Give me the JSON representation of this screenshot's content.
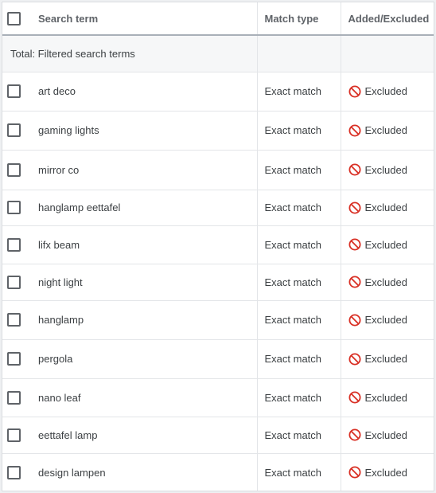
{
  "header": {
    "search_term": "Search term",
    "match_type": "Match type",
    "added_excluded": "Added/Excluded"
  },
  "total": {
    "label": "Total: Filtered search terms"
  },
  "rows": [
    {
      "term": "art deco",
      "match": "Exact match",
      "status": "Excluded"
    },
    {
      "term": "gaming lights",
      "match": "Exact match",
      "status": "Excluded"
    },
    {
      "term": "mirror co",
      "match": "Exact match",
      "status": "Excluded"
    },
    {
      "term": "hanglamp eettafel",
      "match": "Exact match",
      "status": "Excluded"
    },
    {
      "term": "lifx beam",
      "match": "Exact match",
      "status": "Excluded"
    },
    {
      "term": "night light",
      "match": "Exact match",
      "status": "Excluded"
    },
    {
      "term": "hanglamp",
      "match": "Exact match",
      "status": "Excluded"
    },
    {
      "term": "pergola",
      "match": "Exact match",
      "status": "Excluded"
    },
    {
      "term": "nano leaf",
      "match": "Exact match",
      "status": "Excluded"
    },
    {
      "term": "eettafel lamp",
      "match": "Exact match",
      "status": "Excluded"
    },
    {
      "term": "design lampen",
      "match": "Exact match",
      "status": "Excluded"
    }
  ],
  "icons": {
    "excluded": "ban-icon",
    "checkbox": "checkbox-icon"
  },
  "colors": {
    "excluded_icon": "#d93025",
    "header_divider": "#a9b0b8",
    "total_row_bg": "#f6f7f8"
  }
}
